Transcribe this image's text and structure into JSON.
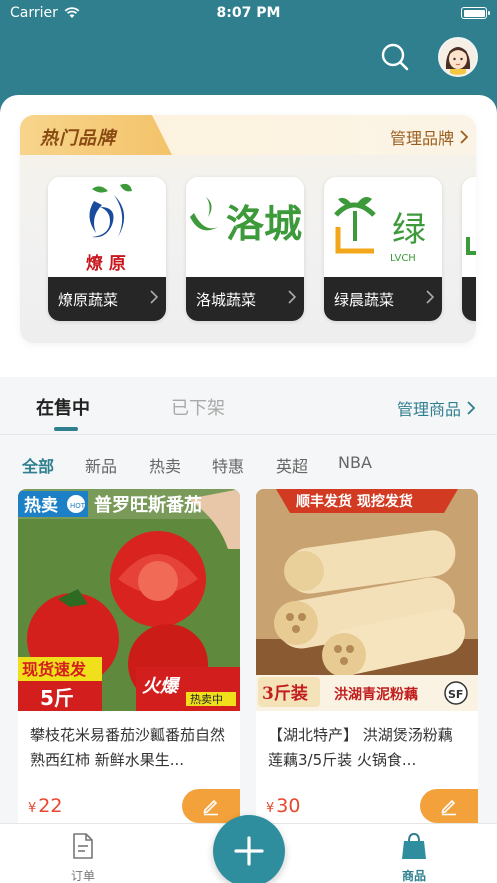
{
  "status_bar": {
    "carrier": "Carrier",
    "time": "8:07 PM"
  },
  "header": {
    "search_icon": "search-icon",
    "avatar": "avatar"
  },
  "brands": {
    "title": "热门品牌",
    "manage_label": "管理品牌",
    "items": [
      {
        "name": "燎原蔬菜",
        "logo_text": "燎 原"
      },
      {
        "name": "洛城蔬菜",
        "logo_text": "洛城"
      },
      {
        "name": "绿晨蔬菜",
        "logo_text": "绿",
        "logo_sub": "LVCH"
      }
    ]
  },
  "tabs": {
    "on_sale": "在售中",
    "off_shelf": "已下架",
    "manage_goods": "管理商品"
  },
  "categories": [
    "全部",
    "新品",
    "热卖",
    "特惠",
    "英超",
    "NBA"
  ],
  "products": [
    {
      "banner_left": "热卖",
      "banner_right": "普罗旺斯番茄",
      "promo1": "现货速发",
      "promo2": "5斤",
      "hot_tag": "火爆",
      "hot_sub": "热卖中",
      "name": "攀枝花米易番茄沙瓤番茄自然熟西红柿 新鲜水果生...",
      "currency": "¥",
      "price": "22"
    },
    {
      "banner_top": "顺丰发货 现挖发货",
      "promo1": "3斤装",
      "promo2": "洪湖青泥粉藕",
      "sf": "SF",
      "name": "【湖北特产】 洪湖煲汤粉藕 莲藕3/5斤装 火锅食...",
      "currency": "¥",
      "price": "30"
    }
  ],
  "bottom_nav": {
    "orders": "订单",
    "goods": "商品"
  },
  "colors": {
    "primary": "#2f7f8f",
    "accent": "#f3a13a",
    "price": "#e8472f"
  }
}
